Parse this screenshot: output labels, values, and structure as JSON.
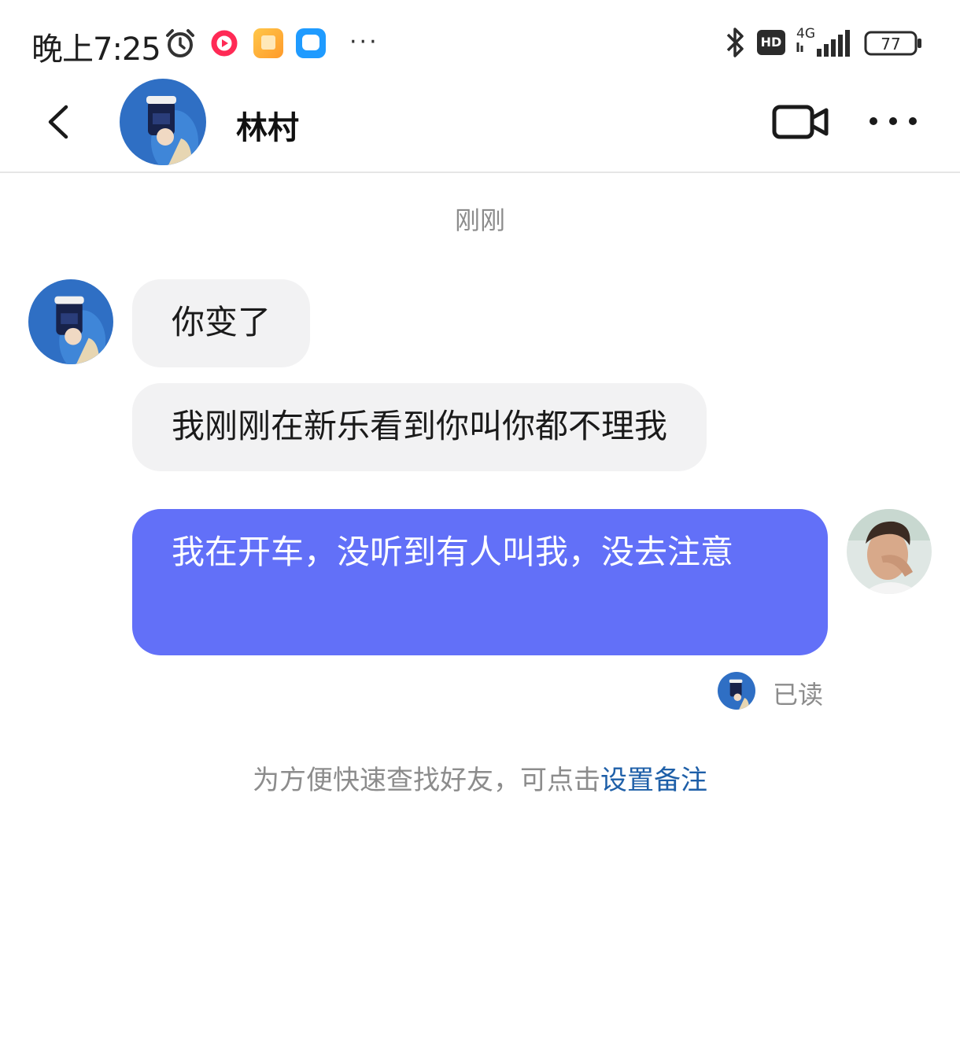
{
  "status_bar": {
    "time": "晚上7:25",
    "network": "4G",
    "hd": "HD",
    "battery": "77",
    "icons": [
      "alarm-icon",
      "app-notification-icon",
      "gallery-app-icon",
      "message-app-icon",
      "more-icon",
      "bluetooth-icon",
      "hd-icon",
      "signal-icon",
      "battery-icon"
    ]
  },
  "header": {
    "contact_name": "林村",
    "icons": [
      "back-icon",
      "video-call-icon",
      "more-icon"
    ]
  },
  "chat": {
    "timestamp": "刚刚",
    "messages": [
      {
        "from": "contact",
        "text": "你变了"
      },
      {
        "from": "contact",
        "text": "我刚刚在新乐看到你叫你都不理我"
      },
      {
        "from": "me",
        "text": "我在开车，没听到有人叫我，没去注意"
      }
    ],
    "read_status": "已读",
    "hint_text": "为方便快速查找好友，可点击",
    "hint_link": "设置备注"
  },
  "colors": {
    "outgoing_bubble": "#6270f8",
    "incoming_bubble": "#f2f2f3",
    "link": "#1e5fa8",
    "muted_text": "#8c8c8c"
  }
}
